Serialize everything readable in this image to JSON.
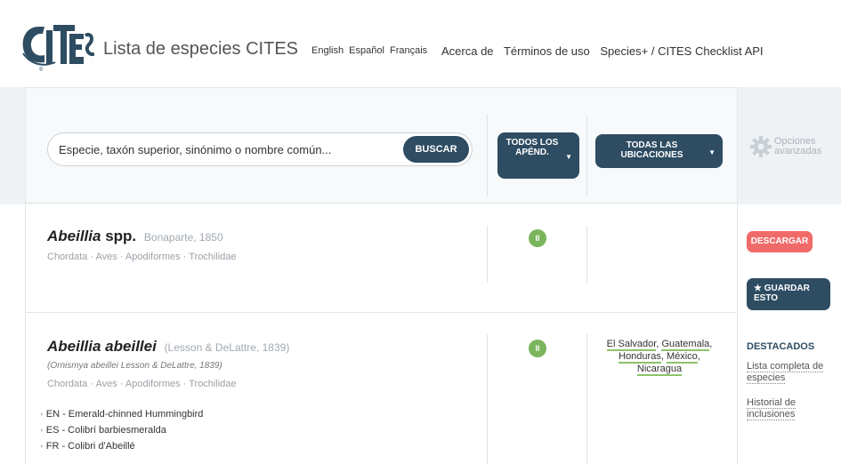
{
  "header": {
    "logo_text": "CITES",
    "site_title": "Lista de especies CITES",
    "languages": [
      "English",
      "Español",
      "Français"
    ],
    "nav": [
      "Acerca de",
      "Términos de uso",
      "Species+ / CITES Checklist API"
    ]
  },
  "search": {
    "placeholder": "Especie, taxón superior, sinónimo o nombre común...",
    "button_label": "BUSCAR"
  },
  "filters": {
    "appendices_label": "TODOS LOS APÉND.",
    "locations_label": "TODAS LAS UBICACIONES",
    "advanced_label": "Opciones avanzadas"
  },
  "results": [
    {
      "genus": "Abeillia",
      "rank": "spp.",
      "author": "Bonaparte, 1850",
      "taxonomy": [
        "Chordata",
        "Aves",
        "Apodiformes",
        "Trochilidae"
      ],
      "appendix": "II",
      "locations": []
    },
    {
      "name": "Abeillia abeillei",
      "author": "(Lesson & DeLattre, 1839)",
      "synonym": "(Ornismya abeillei Lesson & DeLattre, 1839)",
      "taxonomy": [
        "Chordata",
        "Aves",
        "Apodiformes",
        "Trochilidae"
      ],
      "appendix": "II",
      "locations": [
        "El Salvador",
        "Guatemala",
        "Honduras",
        "México",
        "Nicaragua"
      ],
      "common_names": [
        "EN - Emerald-chinned Hummingbird",
        "ES - Colibrí barbiesmeralda",
        "FR - Colibri d'Abeillé"
      ]
    }
  ],
  "sidebar": {
    "download_label": "DESCARGAR",
    "save_label": "★ GUARDAR ESTO",
    "featured_heading": "DESTACADOS",
    "featured_links": [
      "Lista completa de especies",
      "Historial de inclusiones"
    ]
  },
  "colors": {
    "primary": "#2e4c62",
    "download": "#f16a6a",
    "appendix_badge": "#7ab55c"
  }
}
